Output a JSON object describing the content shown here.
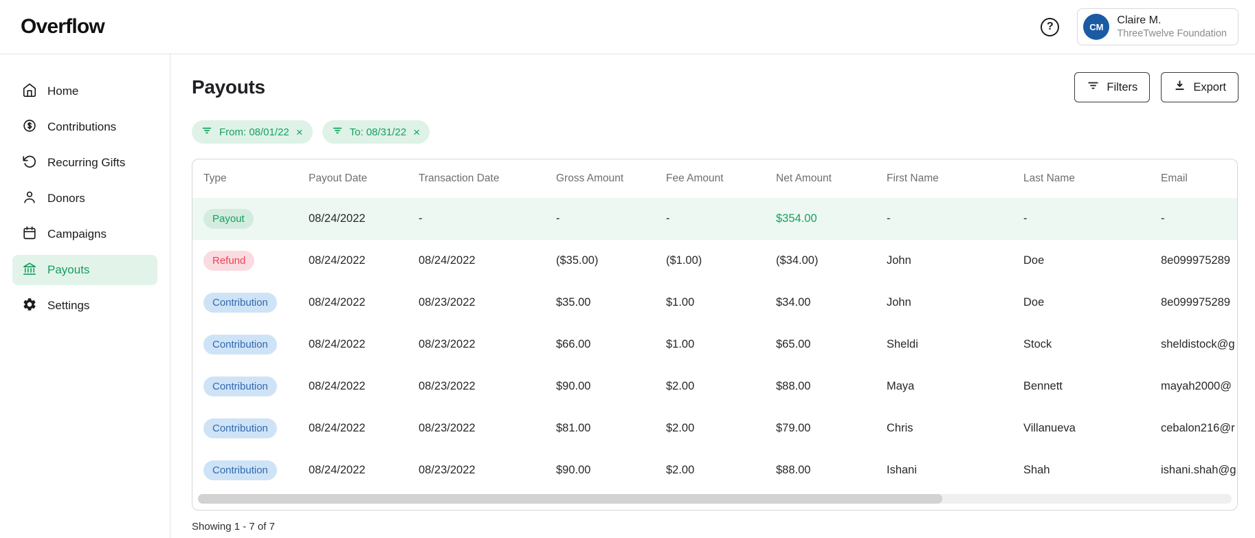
{
  "colors": {
    "accent_green": "#17A05E",
    "accent_green_bg": "#DEF2E7",
    "refund_red": "#EF4155",
    "refund_red_bg": "#FADBE0",
    "contribution_blue": "#3169AE",
    "contribution_blue_bg": "#CFE3F7",
    "avatar_blue": "#1B5BA4",
    "row_highlight": "#EEF8F2"
  },
  "topbar": {
    "logo": "Overflow",
    "help_glyph": "?",
    "user": {
      "initials": "CM",
      "name": "Claire M.",
      "org": "ThreeTwelve Foundation"
    }
  },
  "sidebar": {
    "items": [
      {
        "label": "Home",
        "icon": "home-icon",
        "active": false
      },
      {
        "label": "Contributions",
        "icon": "dollar-circle-icon",
        "active": false
      },
      {
        "label": "Recurring Gifts",
        "icon": "rotate-ccw-icon",
        "active": false
      },
      {
        "label": "Donors",
        "icon": "person-icon",
        "active": false
      },
      {
        "label": "Campaigns",
        "icon": "calendar-icon",
        "active": false
      },
      {
        "label": "Payouts",
        "icon": "bank-icon",
        "active": true
      },
      {
        "label": "Settings",
        "icon": "gear-icon",
        "active": false
      }
    ]
  },
  "page": {
    "title": "Payouts",
    "filters_button_label": "Filters",
    "export_button_label": "Export",
    "chips": [
      {
        "label": "From: 08/01/22",
        "close_glyph": "×"
      },
      {
        "label": "To: 08/31/22",
        "close_glyph": "×"
      }
    ],
    "showing_text": "Showing 1 - 7 of 7"
  },
  "table": {
    "columns": [
      "Type",
      "Payout Date",
      "Transaction Date",
      "Gross Amount",
      "Fee Amount",
      "Net Amount",
      "First Name",
      "Last Name",
      "Email"
    ],
    "rows": [
      {
        "type": "Payout",
        "payout_date": "08/24/2022",
        "transaction_date": "-",
        "gross": "-",
        "fee": "-",
        "net": "$354.00",
        "first": "-",
        "last": "-",
        "email": "-",
        "highlight": true,
        "net_green": true
      },
      {
        "type": "Refund",
        "payout_date": "08/24/2022",
        "transaction_date": "08/24/2022",
        "gross": "($35.00)",
        "fee": "($1.00)",
        "net": "($34.00)",
        "first": "John",
        "last": "Doe",
        "email": "8e099975289",
        "highlight": false,
        "net_green": false
      },
      {
        "type": "Contribution",
        "payout_date": "08/24/2022",
        "transaction_date": "08/23/2022",
        "gross": "$35.00",
        "fee": "$1.00",
        "net": "$34.00",
        "first": "John",
        "last": "Doe",
        "email": "8e099975289",
        "highlight": false,
        "net_green": false
      },
      {
        "type": "Contribution",
        "payout_date": "08/24/2022",
        "transaction_date": "08/23/2022",
        "gross": "$66.00",
        "fee": "$1.00",
        "net": "$65.00",
        "first": "Sheldi",
        "last": "Stock",
        "email": "sheldistock@g",
        "highlight": false,
        "net_green": false
      },
      {
        "type": "Contribution",
        "payout_date": "08/24/2022",
        "transaction_date": "08/23/2022",
        "gross": "$90.00",
        "fee": "$2.00",
        "net": "$88.00",
        "first": "Maya",
        "last": "Bennett",
        "email": "mayah2000@",
        "highlight": false,
        "net_green": false
      },
      {
        "type": "Contribution",
        "payout_date": "08/24/2022",
        "transaction_date": "08/23/2022",
        "gross": "$81.00",
        "fee": "$2.00",
        "net": "$79.00",
        "first": "Chris",
        "last": "Villanueva",
        "email": "cebalon216@r",
        "highlight": false,
        "net_green": false
      },
      {
        "type": "Contribution",
        "payout_date": "08/24/2022",
        "transaction_date": "08/23/2022",
        "gross": "$90.00",
        "fee": "$2.00",
        "net": "$88.00",
        "first": "Ishani",
        "last": "Shah",
        "email": "ishani.shah@g",
        "highlight": false,
        "net_green": false
      }
    ]
  }
}
